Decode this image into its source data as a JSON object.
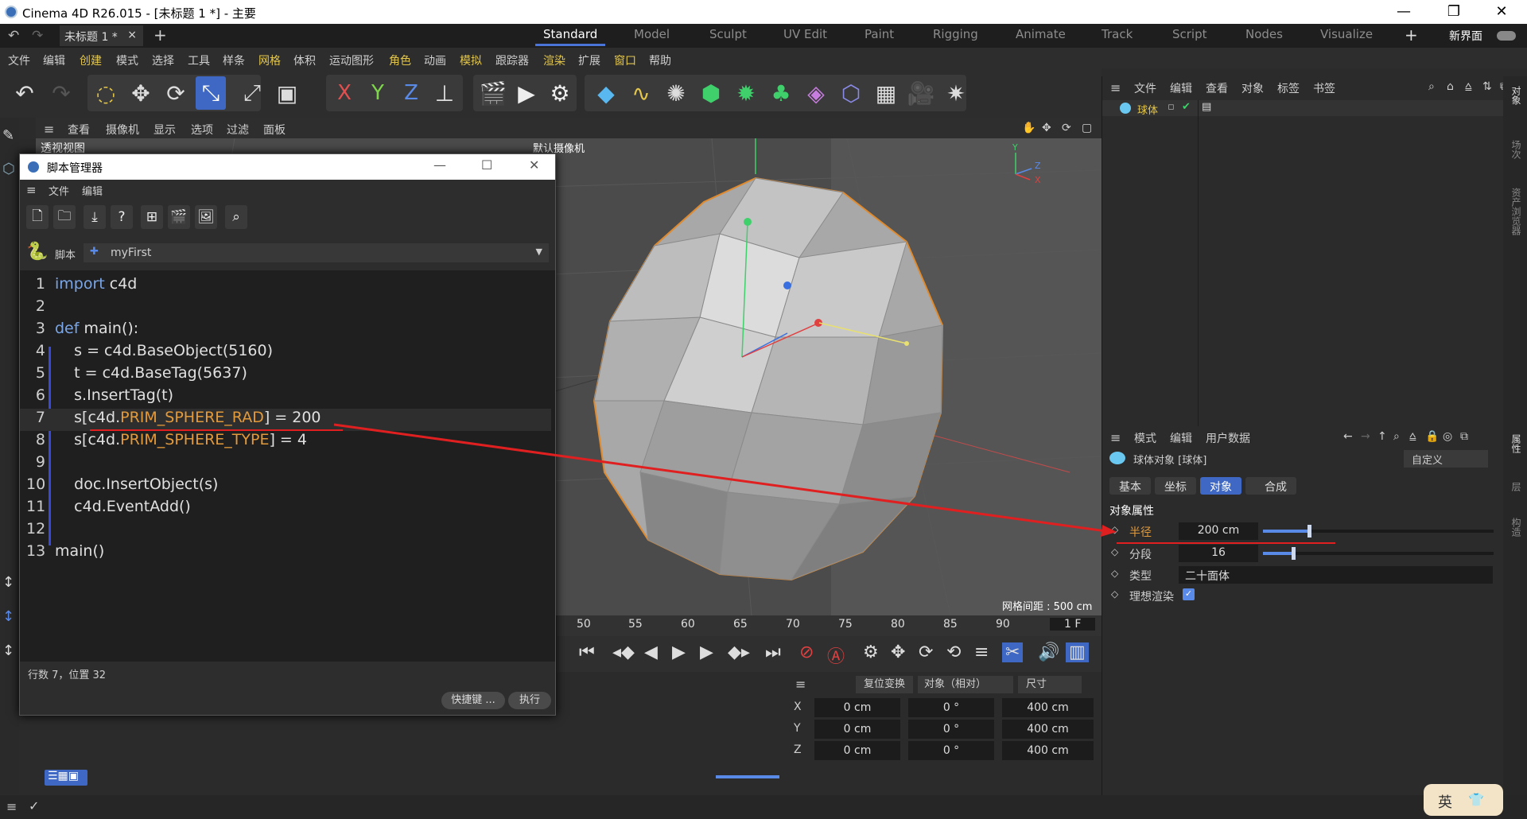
{
  "window": {
    "title": "Cinema 4D R26.015 - [未标题 1 *] - 主要"
  },
  "tabbar": {
    "doc_tab": "未标题 1 *",
    "layouts": [
      "Standard",
      "Model",
      "Sculpt",
      "UV Edit",
      "Paint",
      "Rigging",
      "Animate",
      "Track",
      "Script",
      "Nodes",
      "Visualize"
    ],
    "new_layout": "新界面"
  },
  "menubar": [
    "文件",
    "编辑",
    "创建",
    "模式",
    "选择",
    "工具",
    "样条",
    "网格",
    "体积",
    "运动图形",
    "角色",
    "动画",
    "模拟",
    "跟踪器",
    "渲染",
    "扩展",
    "窗口",
    "帮助"
  ],
  "viewport": {
    "menus": [
      "查看",
      "摄像机",
      "显示",
      "选项",
      "过滤",
      "面板"
    ],
    "view_name": "透视视图",
    "camera": "默认摄像机",
    "grid_spacing": "网格间距 : 500 cm",
    "axes": {
      "y": "Y",
      "z": "Z",
      "x": "X"
    }
  },
  "timeline": {
    "ticks": [
      "50",
      "55",
      "60",
      "65",
      "70",
      "75",
      "80",
      "85",
      "90"
    ],
    "frame": "1 F"
  },
  "coords": {
    "reset": "复位变换",
    "mode": "对象（相对）",
    "size_mode": "尺寸",
    "rows": [
      {
        "axis": "X",
        "pos": "0 cm",
        "rot": "0 °",
        "size": "400 cm"
      },
      {
        "axis": "Y",
        "pos": "0 cm",
        "rot": "0 °",
        "size": "400 cm"
      },
      {
        "axis": "Z",
        "pos": "0 cm",
        "rot": "0 °",
        "size": "400 cm"
      }
    ]
  },
  "object_manager": {
    "menus": [
      "文件",
      "编辑",
      "查看",
      "对象",
      "标签",
      "书签"
    ],
    "object": "球体"
  },
  "attributes": {
    "menus": [
      "模式",
      "编辑",
      "用户数据"
    ],
    "title": "球体对象 [球体]",
    "preset": "自定义",
    "tabs": [
      "基本",
      "坐标",
      "对象",
      "合成"
    ],
    "section": "对象属性",
    "radius_label": "半径",
    "radius_value": "200 cm",
    "segments_label": "分段",
    "segments_value": "16",
    "type_label": "类型",
    "type_value": "二十面体",
    "render_label": "理想渲染",
    "radius_fraction": 0.2,
    "segments_fraction": 0.13
  },
  "right_strip": [
    "对象",
    "场次",
    "资产浏览器",
    "属性",
    "层",
    "构造"
  ],
  "script_manager": {
    "title": "脚本管理器",
    "menus": [
      "文件",
      "编辑"
    ],
    "script_label": "脚本",
    "script_name": "myFirst",
    "code": [
      {
        "n": "1",
        "t": "import c4d"
      },
      {
        "n": "2",
        "t": ""
      },
      {
        "n": "3",
        "t": "def main():"
      },
      {
        "n": "4",
        "t": "    s = c4d.BaseObject(5160)"
      },
      {
        "n": "5",
        "t": "    t = c4d.BaseTag(5637)"
      },
      {
        "n": "6",
        "t": "    s.InsertTag(t)"
      },
      {
        "n": "7",
        "t": "    s[c4d.PRIM_SPHERE_RAD] = 200"
      },
      {
        "n": "8",
        "t": "    s[c4d.PRIM_SPHERE_TYPE] = 4"
      },
      {
        "n": "9",
        "t": ""
      },
      {
        "n": "10",
        "t": "    doc.InsertObject(s)"
      },
      {
        "n": "11",
        "t": "    c4d.EventAdd()"
      },
      {
        "n": "12",
        "t": ""
      },
      {
        "n": "13",
        "t": "main()"
      }
    ],
    "status": "行数 7，位置 32",
    "shortcut_btn": "快捷键 ...",
    "run_btn": "执行"
  },
  "ime": {
    "label": "英"
  }
}
